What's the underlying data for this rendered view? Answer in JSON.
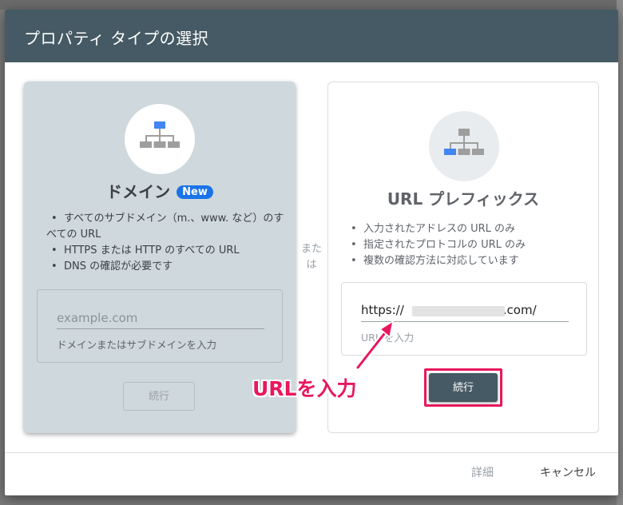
{
  "dialog": {
    "title": "プロパティ タイプの選択"
  },
  "domain_card": {
    "title": "ドメイン",
    "badge": "New",
    "features": [
      "すべてのサブドメイン（m.、www. など）のすべての URL",
      "HTTPS または HTTP のすべての URL",
      "DNS の確認が必要です"
    ],
    "input_placeholder": "example.com",
    "input_hint": "ドメインまたはサブドメインを入力",
    "continue_label": "続行",
    "icon": "sitemap-icon"
  },
  "separator": {
    "line1": "また",
    "line2": "は"
  },
  "url_card": {
    "title": "URL プレフィックス",
    "features": [
      "入力されたアドレスの URL のみ",
      "指定されたプロトコルの URL のみ",
      "複数の確認方法に対応しています"
    ],
    "input_prefix": "https://",
    "input_suffix": ".com/",
    "input_hint": "URL を入力",
    "continue_label": "続行",
    "icon": "sitemap-icon"
  },
  "footer": {
    "details_label": "詳細",
    "cancel_label": "キャンセル"
  },
  "annotation": {
    "text": "URLを入力"
  },
  "colors": {
    "header": "#455a64",
    "accent_blue": "#4285f4",
    "highlight": "#e8175d",
    "domain_card_bg": "#cfd8dc"
  }
}
